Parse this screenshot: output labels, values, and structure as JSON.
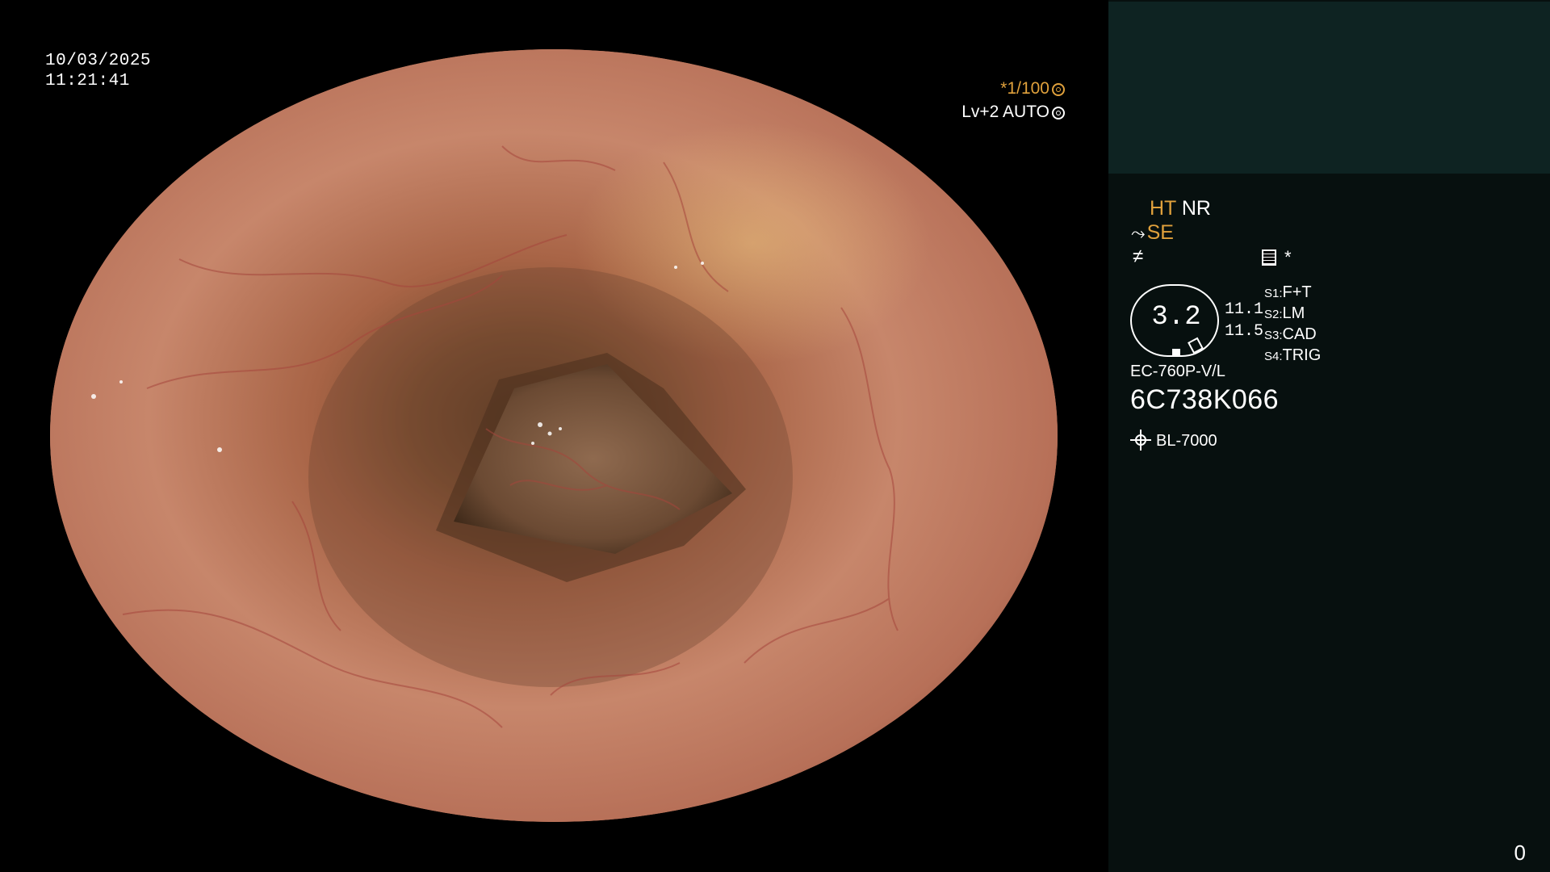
{
  "osd": {
    "date": "10/03/2025",
    "time": "11:21:41",
    "shutter": "*1/100",
    "level": "Lv+2 AUTO"
  },
  "panel": {
    "ht": "HT",
    "nr": "NR",
    "se": "SE",
    "asterisk": "*",
    "gauge_value": "3.2",
    "pressure": [
      "11.1",
      "11.5"
    ],
    "s_items": [
      {
        "key": "S1:",
        "value": "F+T"
      },
      {
        "key": "S2:",
        "value": "LM"
      },
      {
        "key": "S3:",
        "value": "CAD"
      },
      {
        "key": "S4:",
        "value": "TRIG"
      }
    ],
    "scope_model": "EC-760P-V/L",
    "serial": "6C738K066",
    "light_source": "BL-7000",
    "counter": "0"
  },
  "colors": {
    "accent_orange": "#e0a13c",
    "panel_bg": "#07100f",
    "preview_bg": "#0e2322",
    "mucosa": "#b86f55"
  },
  "icons": [
    "shutter-icon",
    "auto-iris-icon",
    "scope-tip-icon",
    "menu-list-icon",
    "light-source-icon"
  ]
}
